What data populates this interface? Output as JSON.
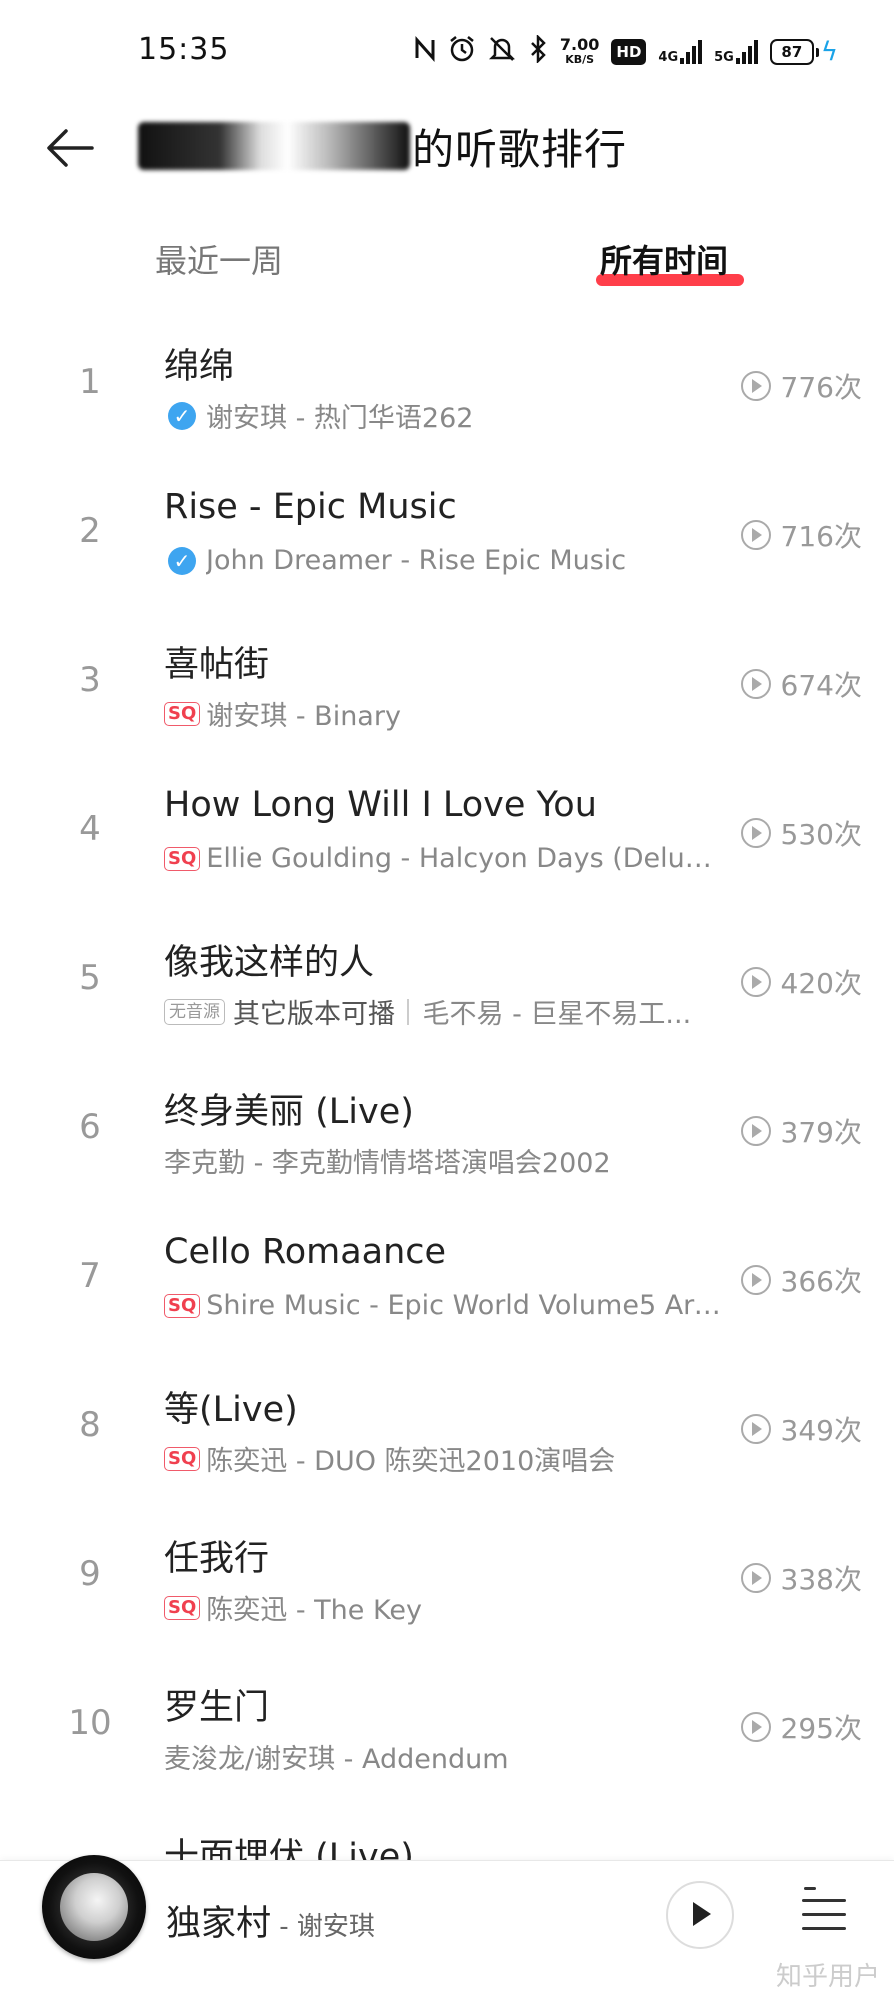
{
  "status_bar": {
    "time": "15:35",
    "speed_value": "7.00",
    "speed_unit": "KB/S",
    "hd_label": "HD",
    "net1": "4G",
    "net2": "5G",
    "battery": "87"
  },
  "header": {
    "title_suffix": "的听歌排行"
  },
  "tabs": {
    "recent": "最近一周",
    "all": "所有时间",
    "active": "all"
  },
  "songs": [
    {
      "rank": "1",
      "title": "绵绵",
      "badge": "verified",
      "meta": "谢安琪 - 热门华语262",
      "plays": "776次"
    },
    {
      "rank": "2",
      "title": "Rise - Epic Music",
      "badge": "verified",
      "meta": "John Dreamer - Rise   Epic Music",
      "plays": "716次"
    },
    {
      "rank": "3",
      "title": "喜帖街",
      "badge": "SQ",
      "meta": "谢安琪 - Binary",
      "plays": "674次"
    },
    {
      "rank": "4",
      "title": "How Long Will I Love You",
      "badge": "SQ",
      "meta": "Ellie Goulding - Halcyon Days (Deluxe...",
      "plays": "530次"
    },
    {
      "rank": "5",
      "title": "像我这样的人",
      "badge": "无音源",
      "alt": "其它版本可播",
      "meta": "毛不易 - 巨星不易工...",
      "plays": "420次"
    },
    {
      "rank": "6",
      "title": "终身美丽 (Live)",
      "badge": "",
      "meta": "李克勤 - 李克勤情情塔塔演唱会2002",
      "plays": "379次"
    },
    {
      "rank": "7",
      "title": "Cello Romaance",
      "badge": "SQ",
      "meta": "Shire Music - Epic World Volume5 Arc...",
      "plays": "366次"
    },
    {
      "rank": "8",
      "title": "等(Live)",
      "badge": "SQ",
      "meta": "陈奕迅 - DUO 陈奕迅2010演唱会",
      "plays": "349次"
    },
    {
      "rank": "9",
      "title": "任我行",
      "badge": "SQ",
      "meta": "陈奕迅 - The Key",
      "plays": "338次"
    },
    {
      "rank": "10",
      "title": "罗生门",
      "badge": "",
      "meta": "麦浚龙/谢安琪 - Addendum",
      "plays": "295次"
    },
    {
      "rank": "",
      "title": "十面埋伏 (Live)",
      "badge": "",
      "meta": "",
      "plays": ""
    }
  ],
  "player": {
    "song": "独家村",
    "artist": " - 谢安琪"
  },
  "watermark": "知乎用户",
  "colors": {
    "accent": "#ff3e4a",
    "verified": "#3ea5f0",
    "sq": "#f0404f"
  }
}
